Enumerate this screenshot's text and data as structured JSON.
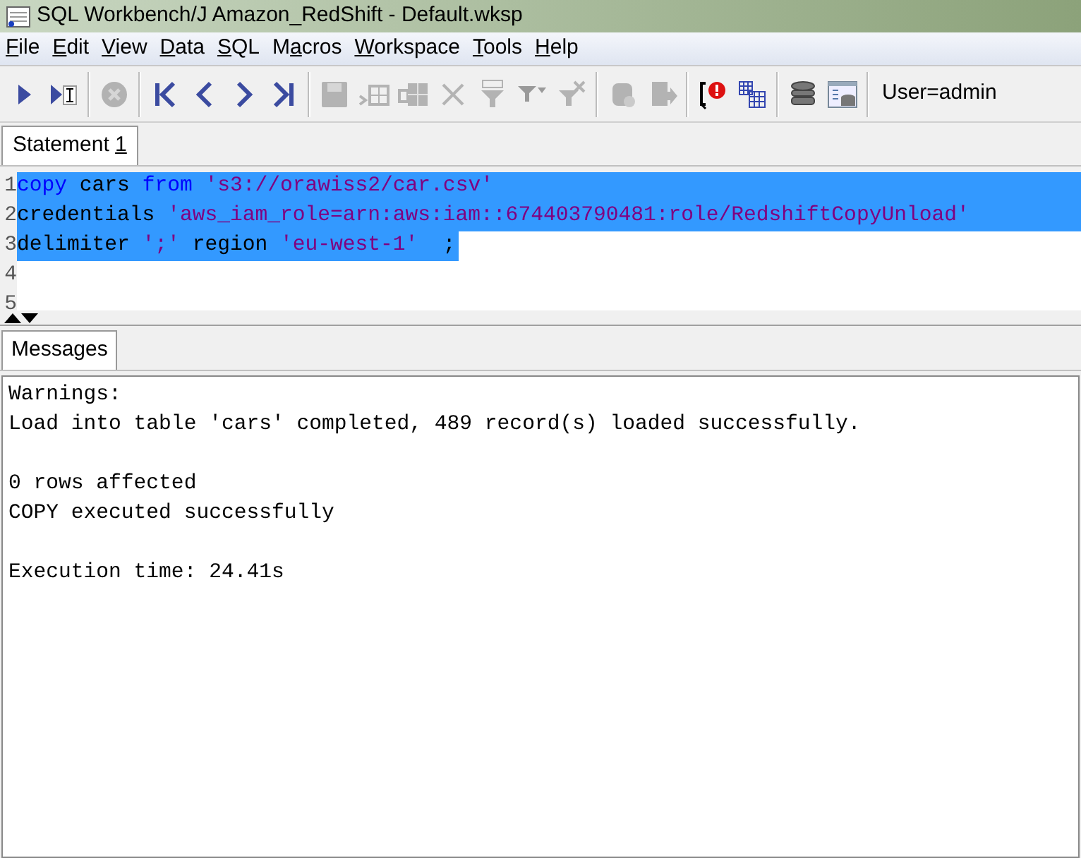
{
  "window": {
    "title": "SQL Workbench/J Amazon_RedShift - Default.wksp"
  },
  "menu": [
    {
      "key": "F",
      "after": "ile"
    },
    {
      "key": "E",
      "after": "dit"
    },
    {
      "key": "V",
      "after": "iew"
    },
    {
      "key": "D",
      "after": "ata"
    },
    {
      "key": "S",
      "after": "QL"
    },
    {
      "before": "M",
      "key": "a",
      "after": "cros"
    },
    {
      "key": "W",
      "after": "orkspace"
    },
    {
      "key": "T",
      "after": "ools"
    },
    {
      "key": "H",
      "after": "elp"
    }
  ],
  "toolbar": [
    {
      "kind": "execute",
      "disabled": false
    },
    {
      "kind": "execute-current",
      "disabled": false
    },
    {
      "kind": "sep"
    },
    {
      "kind": "stop",
      "disabled": true
    },
    {
      "kind": "sep"
    },
    {
      "kind": "first",
      "disabled": false
    },
    {
      "kind": "prev",
      "disabled": false
    },
    {
      "kind": "next",
      "disabled": false
    },
    {
      "kind": "last",
      "disabled": false
    },
    {
      "kind": "sep"
    },
    {
      "kind": "save",
      "disabled": true
    },
    {
      "kind": "insert-row",
      "disabled": true
    },
    {
      "kind": "copy-row",
      "disabled": true
    },
    {
      "kind": "delete",
      "disabled": true
    },
    {
      "kind": "filter",
      "disabled": true
    },
    {
      "kind": "filter-menu",
      "disabled": true
    },
    {
      "kind": "clear-filter",
      "disabled": true
    },
    {
      "kind": "sep"
    },
    {
      "kind": "commit",
      "disabled": true
    },
    {
      "kind": "rollback",
      "disabled": true
    },
    {
      "kind": "sep"
    },
    {
      "kind": "error-jump",
      "disabled": false
    },
    {
      "kind": "grid",
      "disabled": false
    },
    {
      "kind": "sep"
    },
    {
      "kind": "database",
      "disabled": false
    },
    {
      "kind": "db-explorer",
      "disabled": false
    },
    {
      "kind": "sep"
    }
  ],
  "connection": "User=admin",
  "editor_tabs": [
    {
      "before": "Statement ",
      "key": "1",
      "selected": true
    }
  ],
  "editor_lines": [
    {
      "number": "1",
      "selected": true,
      "full_width": true,
      "tokens": [
        {
          "kind": "keyword",
          "text": "copy"
        },
        {
          "kind": "plain",
          "text": " cars "
        },
        {
          "kind": "keyword",
          "text": "from"
        },
        {
          "kind": "string",
          "text": " 's3://orawiss2/car.csv'"
        }
      ]
    },
    {
      "number": "2",
      "selected": true,
      "full_width": true,
      "tokens": [
        {
          "kind": "plain",
          "text": "credentials "
        },
        {
          "kind": "string",
          "text": "'aws_iam_role=arn:aws:iam::674403790481:role/RedshiftCopyUnload'"
        }
      ]
    },
    {
      "number": "3",
      "selected": true,
      "full_width": false,
      "tokens": [
        {
          "kind": "plain",
          "text": "delimiter "
        },
        {
          "kind": "string",
          "text": "';'"
        },
        {
          "kind": "plain",
          "text": " region "
        },
        {
          "kind": "string",
          "text": "'eu-west-1'"
        },
        {
          "kind": "plain",
          "text": "  ;"
        }
      ]
    },
    {
      "number": "4",
      "selected": false
    },
    {
      "number": "5",
      "selected": false
    }
  ],
  "result_tabs": [
    {
      "label": "Messages",
      "selected": true
    }
  ],
  "message_blocks": [
    [
      "Warnings:",
      "Load into table 'cars' completed, 489 record(s) loaded successfully."
    ],
    [
      "0 rows affected",
      "COPY executed successfully"
    ],
    [
      "Execution time: 24.41s"
    ]
  ]
}
